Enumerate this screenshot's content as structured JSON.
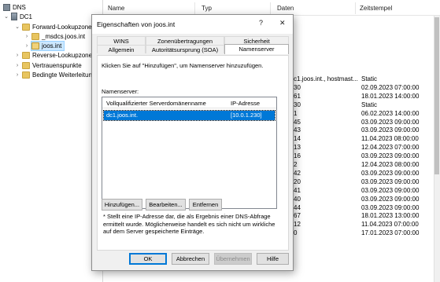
{
  "tree": {
    "items": [
      {
        "label": "DNS",
        "icon": "dns-icon",
        "expander": ""
      },
      {
        "label": "DC1",
        "icon": "server-icon",
        "expander": "⌄"
      },
      {
        "label": "Forward-Lookupzonen",
        "icon": "folder-icon",
        "expander": "⌄"
      },
      {
        "label": "_msdcs.joos.int",
        "icon": "folder-icon",
        "expander": "›"
      },
      {
        "label": "joos.int",
        "icon": "folder-icon",
        "expander": "›"
      },
      {
        "label": "Reverse-Lookupzonen",
        "icon": "folder-icon",
        "expander": "›"
      },
      {
        "label": "Vertrauenspunkte",
        "icon": "folder-icon",
        "expander": "›"
      },
      {
        "label": "Bedingte Weiterleitungen",
        "icon": "folder-icon",
        "expander": "›"
      }
    ]
  },
  "list": {
    "columns": [
      "Name",
      "Typ",
      "Daten",
      "Zeitstempel"
    ],
    "rows": [
      {
        "data": "c1.joos.int., hostmast...",
        "time": "Static"
      },
      {
        "data": "30",
        "time": "02.09.2023 07:00:00"
      },
      {
        "data": "61",
        "time": "18.01.2023 14:00:00"
      },
      {
        "data": "30",
        "time": "Static"
      },
      {
        "data": "1",
        "time": "06.02.2023 14:00:00"
      },
      {
        "data": "45",
        "time": "03.09.2023 09:00:00"
      },
      {
        "data": "43",
        "time": "03.09.2023 09:00:00"
      },
      {
        "data": "14",
        "time": "11.04.2023 08:00:00"
      },
      {
        "data": "13",
        "time": "12.04.2023 07:00:00"
      },
      {
        "data": "16",
        "time": "03.09.2023 09:00:00"
      },
      {
        "data": "2",
        "time": "12.04.2023 08:00:00"
      },
      {
        "data": "42",
        "time": "03.09.2023 09:00:00"
      },
      {
        "data": "20",
        "time": "03.09.2023 09:00:00"
      },
      {
        "data": "41",
        "time": "03.09.2023 09:00:00"
      },
      {
        "data": "40",
        "time": "03.09.2023 09:00:00"
      },
      {
        "data": "44",
        "time": "03.09.2023 09:00:00"
      },
      {
        "data": "67",
        "time": "18.01.2023 13:00:00"
      },
      {
        "data": "12",
        "time": "11.04.2023 07:00:00"
      },
      {
        "data": "0",
        "time": "17.01.2023 07:00:00"
      }
    ],
    "row_top": 0
  },
  "dialog": {
    "title": "Eigenschaften von joos.int",
    "help_glyph": "?",
    "close_glyph": "✕",
    "tabs_row1": [
      "WINS",
      "Zonenübertragungen",
      "Sicherheit"
    ],
    "tabs_row2": [
      "Allgemein",
      "Autoritätsursprung (SOA)",
      "Namenserver"
    ],
    "active_tab": "Namenserver",
    "instruction": "Klicken Sie auf \"Hinzufügen\", um Namenserver hinzuzufügen.",
    "ns_label": "Namenserver:",
    "ns_columns": [
      "Vollqualifizierter Serverdomänenname",
      "IP-Adresse"
    ],
    "ns_rows": [
      {
        "fqdn": "dc1.joos.int.",
        "ip": "[10.0.1.230]"
      }
    ],
    "btn_add": "Hinzufügen...",
    "btn_edit": "Bearbeiten...",
    "btn_remove": "Entfernen",
    "note": "* Stellt eine IP-Adresse dar, die als Ergebnis einer DNS-Abfrage ermittelt wurde. Möglicherweise handelt es sich nicht um wirkliche auf dem Server gespeicherte Einträge.",
    "btn_ok": "OK",
    "btn_cancel": "Abbrechen",
    "btn_apply": "Übernehmen",
    "btn_help": "Hilfe"
  },
  "colors": {
    "accent": "#0078d7",
    "selection": "#cce8ff"
  }
}
